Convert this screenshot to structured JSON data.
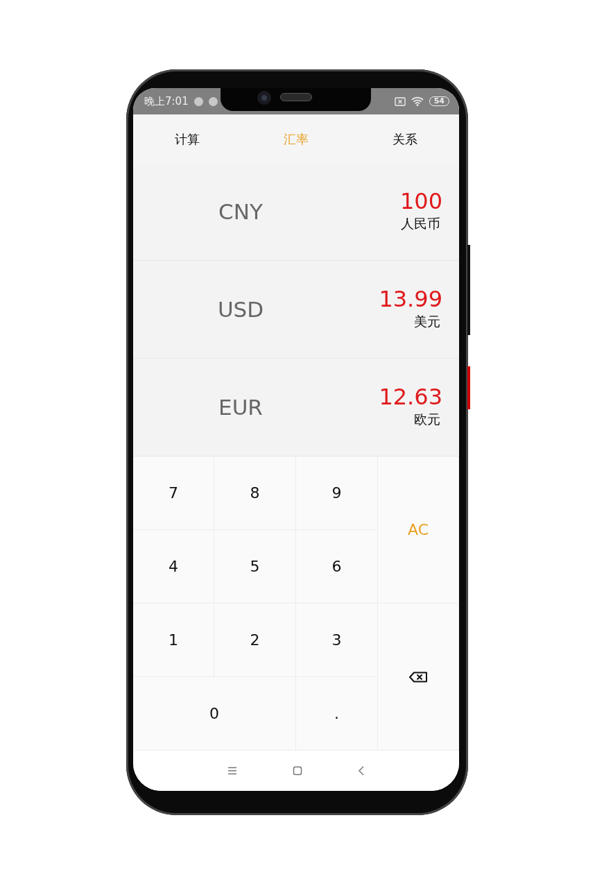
{
  "status_bar": {
    "time": "晚上7:01",
    "battery": "54"
  },
  "tabs": [
    {
      "label": "计算",
      "selected": false
    },
    {
      "label": "汇率",
      "selected": true
    },
    {
      "label": "关系",
      "selected": false
    }
  ],
  "currencies": [
    {
      "code": "CNY",
      "amount": "100",
      "name": "人民币"
    },
    {
      "code": "USD",
      "amount": "13.99",
      "name": "美元"
    },
    {
      "code": "EUR",
      "amount": "12.63",
      "name": "欧元"
    }
  ],
  "keypad": [
    {
      "kind": "digit",
      "label": "7"
    },
    {
      "kind": "digit",
      "label": "8"
    },
    {
      "kind": "digit",
      "label": "9"
    },
    {
      "kind": "clear",
      "label": "AC"
    },
    {
      "kind": "digit",
      "label": "4"
    },
    {
      "kind": "digit",
      "label": "5"
    },
    {
      "kind": "digit",
      "label": "6"
    },
    {
      "kind": "digit",
      "label": "1"
    },
    {
      "kind": "digit",
      "label": "2"
    },
    {
      "kind": "digit",
      "label": "3"
    },
    {
      "kind": "backspace"
    },
    {
      "kind": "digit",
      "label": "0"
    },
    {
      "kind": "digit",
      "label": "."
    }
  ]
}
